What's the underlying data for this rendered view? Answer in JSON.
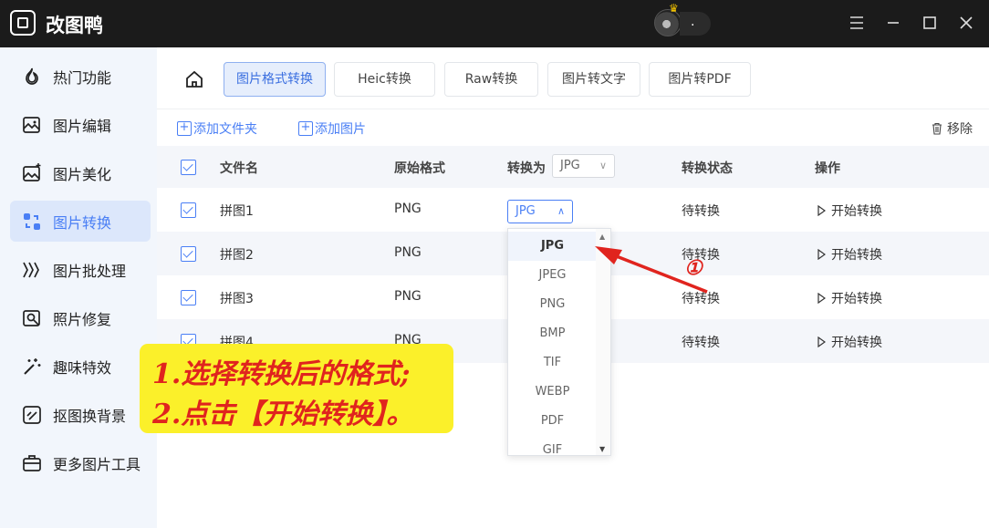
{
  "app": {
    "title": "改图鸭",
    "user_label": "."
  },
  "sidebar": {
    "items": [
      {
        "label": "热门功能",
        "icon": "fire-icon"
      },
      {
        "label": "图片编辑",
        "icon": "image-edit-icon"
      },
      {
        "label": "图片美化",
        "icon": "image-beautify-icon"
      },
      {
        "label": "图片转换",
        "icon": "convert-icon",
        "active": true
      },
      {
        "label": "图片批处理",
        "icon": "batch-icon"
      },
      {
        "label": "照片修复",
        "icon": "photo-repair-icon"
      },
      {
        "label": "趣味特效",
        "icon": "magic-wand-icon"
      },
      {
        "label": "抠图换背景",
        "icon": "cutout-icon"
      },
      {
        "label": "更多图片工具",
        "icon": "toolbox-icon"
      }
    ]
  },
  "tabs": [
    {
      "label": "图片格式转换",
      "active": true
    },
    {
      "label": "Heic转换"
    },
    {
      "label": "Raw转换"
    },
    {
      "label": "图片转文字"
    },
    {
      "label": "图片转PDF"
    }
  ],
  "toolbar": {
    "add_folder": "添加文件夹",
    "add_image": "添加图片",
    "remove": "移除"
  },
  "table": {
    "headers": {
      "name": "文件名",
      "orig_format": "原始格式",
      "convert_to": "转换为",
      "convert_to_value": "JPG",
      "status": "转换状态",
      "action": "操作"
    },
    "rows": [
      {
        "name": "拼图1",
        "format": "PNG",
        "target": "JPG",
        "status": "待转换",
        "action": "开始转换"
      },
      {
        "name": "拼图2",
        "format": "PNG",
        "status": "待转换",
        "action": "开始转换"
      },
      {
        "name": "拼图3",
        "format": "PNG",
        "status": "待转换",
        "action": "开始转换"
      },
      {
        "name": "拼图4",
        "format": "PNG",
        "status": "待转换",
        "action": "开始转换"
      }
    ]
  },
  "dropdown": {
    "options": [
      "JPG",
      "JPEG",
      "PNG",
      "BMP",
      "TIF",
      "WEBP",
      "PDF",
      "GIF"
    ],
    "selected": "JPG"
  },
  "annotation": {
    "line1": "1.选择转换后的格式;",
    "line2": "2.点击【开始转换】。",
    "step_marker": "①"
  },
  "colors": {
    "accent": "#4a7ff5",
    "annotation_red": "#e0241e",
    "callout_yellow": "#fbf02a"
  }
}
